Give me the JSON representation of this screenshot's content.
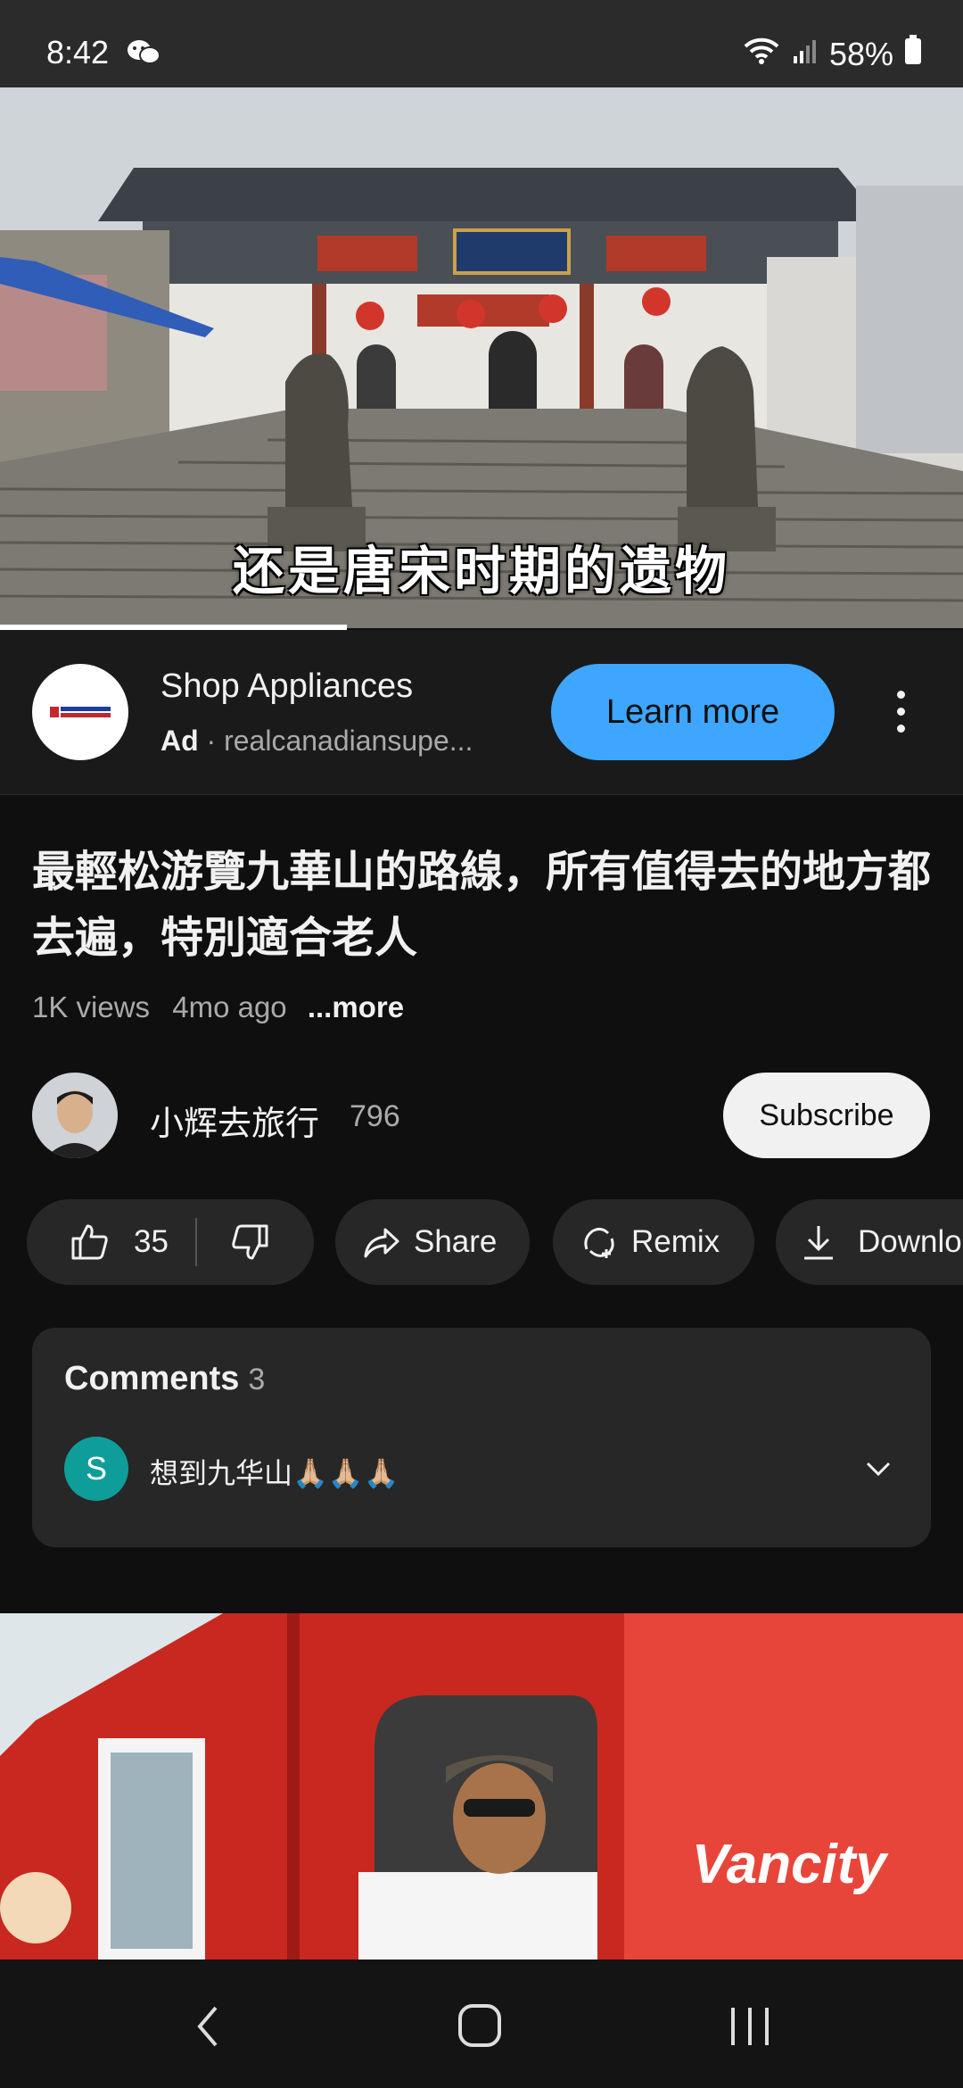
{
  "status_bar": {
    "time": "8:42",
    "battery": "58%"
  },
  "video": {
    "subtitle": "还是唐宋时期的遗物",
    "progress_fraction": 0.36
  },
  "ad": {
    "title": "Shop Appliances",
    "label": "Ad",
    "separator": "·",
    "domain": "realcanadiansupe...",
    "cta_label": "Learn more"
  },
  "video_title": "最輕松游覽九華山的路線，所有值得去的地方都去遍，特別適合老人",
  "meta": {
    "views": "1K views",
    "age": "4mo ago",
    "more": "...more"
  },
  "channel": {
    "name": "小辉去旅行",
    "subscribers": "796",
    "subscribe_label": "Subscribe"
  },
  "actions": {
    "likes": "35",
    "share": "Share",
    "remix": "Remix",
    "download": "Downlo"
  },
  "comments": {
    "heading": "Comments",
    "count": "3",
    "first_avatar": "S",
    "first_text": "想到九华山🙏🏼🙏🏼🙏🏼"
  },
  "promo": {
    "brand": "Vancity"
  },
  "colors": {
    "accent": "#3ea6ff",
    "background": "#0f0f0f",
    "pill": "#272727",
    "promo_red": "#e8453a"
  }
}
